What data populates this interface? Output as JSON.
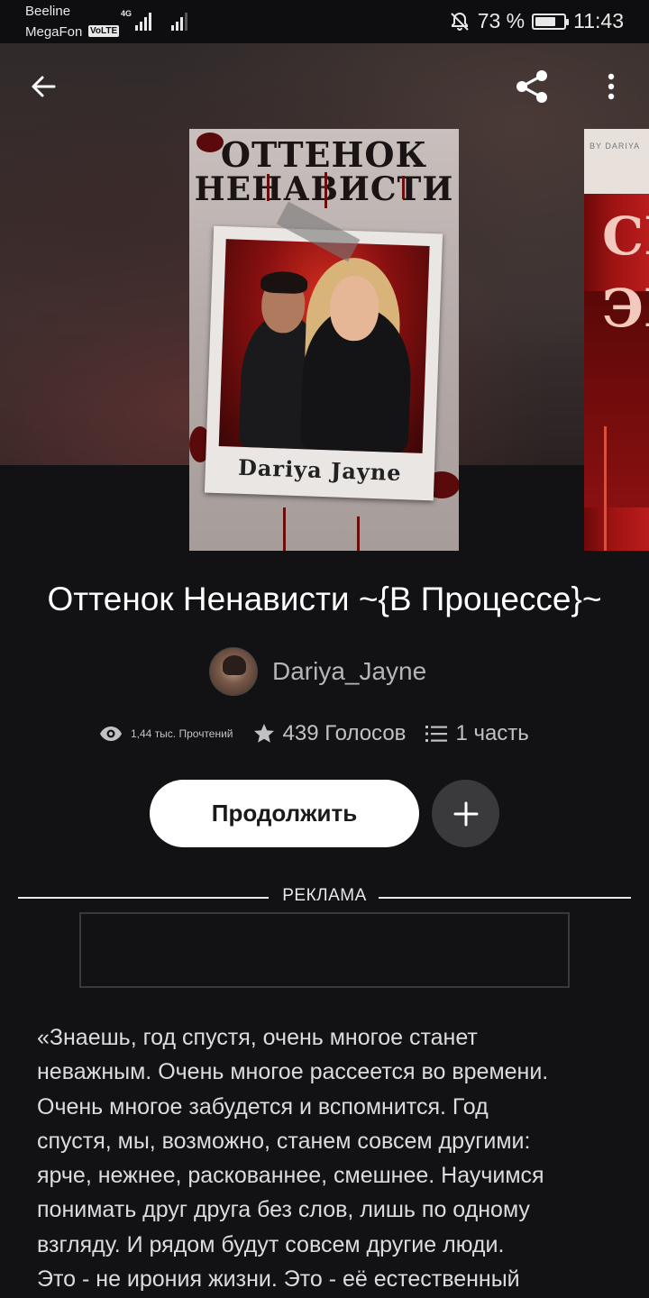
{
  "status_bar": {
    "carrier1": "Beeline",
    "carrier2": "MegaFon",
    "volte": "VoLTE",
    "network": "4G",
    "battery_percent": "73 %",
    "battery_level": 0.73,
    "time": "11:43"
  },
  "toolbar": {
    "back_icon": "arrow-left-icon",
    "share_icon": "share-icon",
    "more_icon": "more-vertical-icon"
  },
  "cover": {
    "title_line1": "ОТТЕНОК",
    "title_line2": "НЕНАВИСТИ",
    "author": "Dariya Jayne"
  },
  "next_cover": {
    "byline": "BY DARIYA",
    "letters1": "СП",
    "letters2": "ЭМ"
  },
  "book": {
    "title": "Оттенок Ненависти ~{В Процессе}~",
    "author": "Dariya_Jayne",
    "reads": "1,44 тыс. Прочтений",
    "votes": "439 Голосов",
    "parts": "1 часть"
  },
  "actions": {
    "continue_label": "Продолжить",
    "add_icon": "plus-icon"
  },
  "ad": {
    "label": "РЕКЛАМА"
  },
  "description": {
    "lines": [
      "«Знаешь, год спустя, очень многое станет",
      "неважным. Очень многое рассеется во времени.",
      "Очень многое забудется и вспомнится. Год",
      "спустя, мы, возможно, станем совсем другими:",
      "ярче, нежнее, раскованнее, смешнее. Научимся",
      "понимать друг друга без слов, лишь по одному",
      "взгляду. И рядом будут совсем другие люди.",
      "Это - не ирония жизни. Это - её естественный"
    ]
  }
}
